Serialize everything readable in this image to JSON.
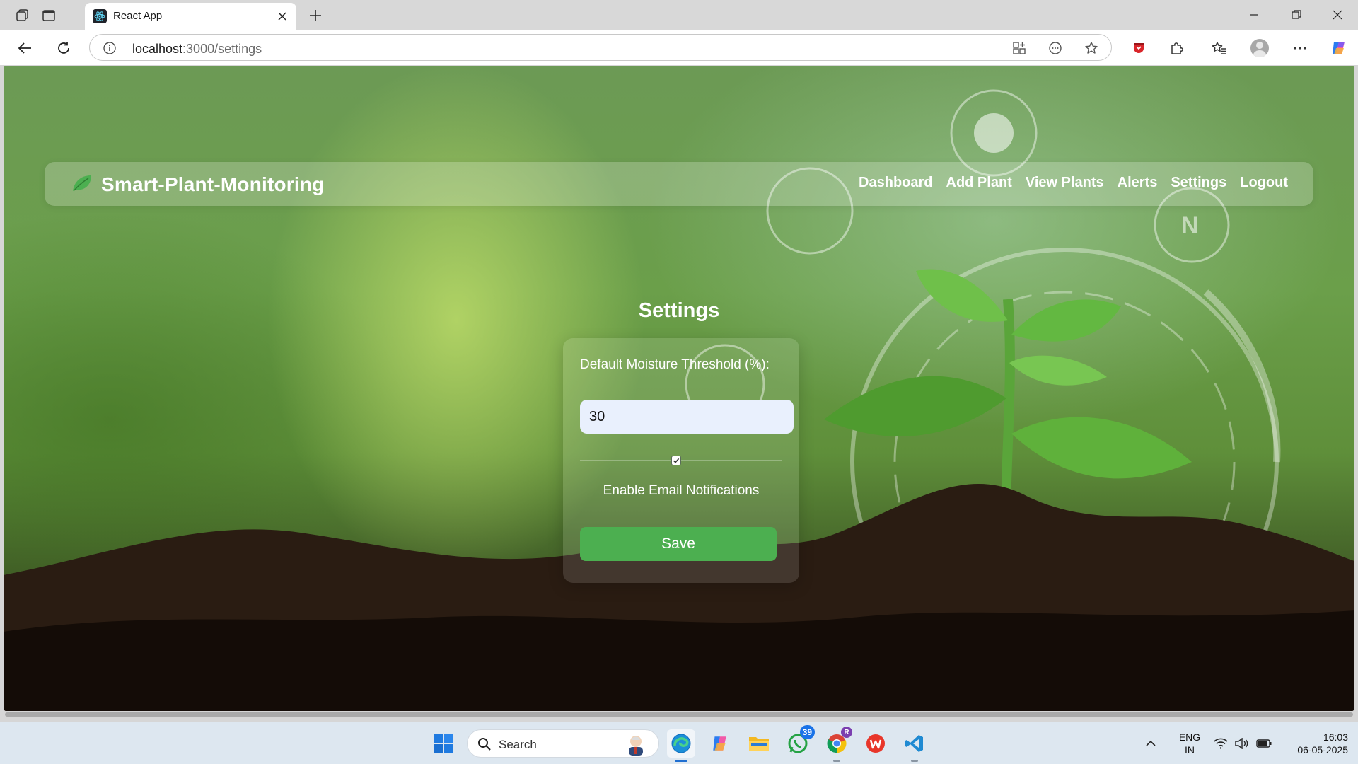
{
  "browser": {
    "tab": {
      "title": "React App"
    },
    "url": {
      "host": "localhost",
      "path": ":3000/settings"
    }
  },
  "app": {
    "brand": "Smart-Plant-Monitoring",
    "nav": [
      {
        "label": "Dashboard"
      },
      {
        "label": "Add Plant"
      },
      {
        "label": "View Plants"
      },
      {
        "label": "Alerts"
      },
      {
        "label": "Settings"
      },
      {
        "label": "Logout"
      }
    ],
    "settings": {
      "title": "Settings",
      "threshold_label": "Default Moisture Threshold (%):",
      "threshold_value": "30",
      "email_notifications_label": "Enable Email Notifications",
      "email_notifications_checked": true,
      "save_label": "Save"
    }
  },
  "taskbar": {
    "search_label": "Search",
    "whatsapp_badge": "39",
    "chrome_profile_badge": "R",
    "lang_line1": "ENG",
    "lang_line2": "IN",
    "time": "16:03",
    "date": "06-05-2025"
  },
  "colors": {
    "save_button": "#4caf50",
    "brand_leaf": "#4caf50",
    "input_background": "#e9f0fd"
  }
}
